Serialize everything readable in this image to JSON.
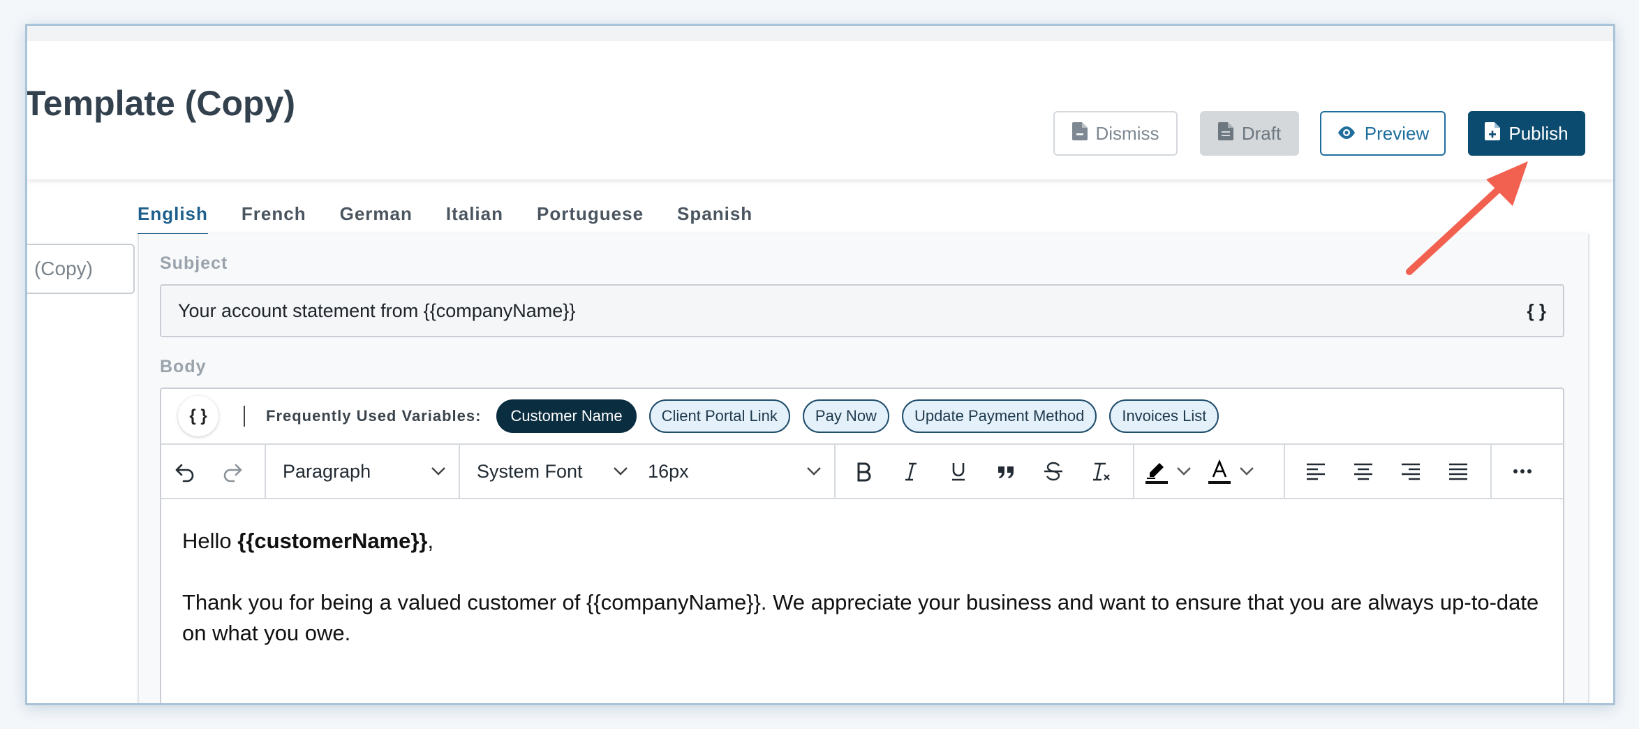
{
  "header": {
    "title": "Template (Copy)",
    "buttons": {
      "dismiss": "Dismiss",
      "draft": "Draft",
      "preview": "Preview",
      "publish": "Publish"
    }
  },
  "name_field": {
    "value": "(Copy)"
  },
  "languages": {
    "tabs": [
      "English",
      "French",
      "German",
      "Italian",
      "Portuguese",
      "Spanish"
    ],
    "active": "English"
  },
  "subject": {
    "label": "Subject",
    "value": "Your account statement from {{companyName}}",
    "variable_button": "{ }"
  },
  "body": {
    "label": "Body",
    "variable_button": "{ }",
    "frequent_label": "Frequently Used Variables:",
    "chips": [
      "Customer Name",
      "Client Portal Link",
      "Pay Now",
      "Update Payment Method",
      "Invoices List"
    ],
    "active_chip": "Customer Name",
    "toolbar": {
      "block_format": "Paragraph",
      "font_family": "System Font",
      "font_size": "16px"
    },
    "content": {
      "greeting_prefix": "Hello ",
      "greeting_variable": "{{customerName}}",
      "greeting_suffix": ",",
      "paragraph": "Thank you for being a valued customer of {{companyName}}. We appreciate your business and want to ensure that you are always up-to-date on what you owe."
    }
  },
  "colors": {
    "primary": "#0c4b70",
    "preview_accent": "#1f6d9d",
    "active_tab": "#1d5f8c",
    "active_chip": "#0b2d40",
    "annotation_arrow": "#f2604f"
  },
  "icons": {
    "dismiss": "file-minus-icon",
    "draft": "file-icon",
    "preview": "eye-icon",
    "publish": "file-plus-icon",
    "undo": "undo-icon",
    "redo": "redo-icon",
    "bold": "bold-icon",
    "italic": "italic-icon",
    "underline": "underline-icon",
    "blockquote": "quote-icon",
    "strikethrough": "strikethrough-icon",
    "clear_format": "clear-format-icon",
    "highlight": "highlighter-icon",
    "text_color": "text-color-icon",
    "align_left": "align-left-icon",
    "align_center": "align-center-icon",
    "align_right": "align-right-icon",
    "justify": "justify-icon",
    "more": "more-icon"
  }
}
